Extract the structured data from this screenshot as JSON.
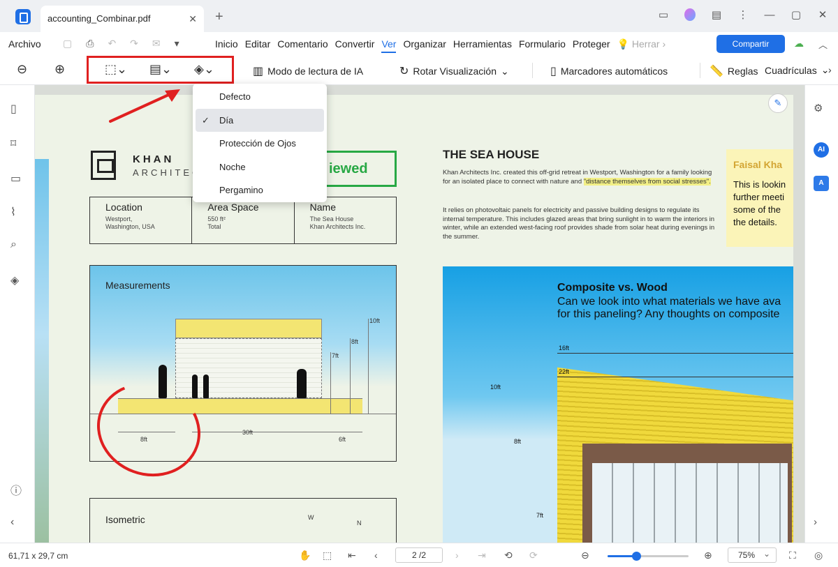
{
  "window": {
    "tab_title": "accounting_Combinar.pdf"
  },
  "menubar": {
    "file": "Archivo",
    "items": [
      "Inicio",
      "Editar",
      "Comentario",
      "Convertir",
      "Ver",
      "Organizar",
      "Herramientas",
      "Formulario",
      "Proteger",
      "Herrar"
    ],
    "active": "Ver",
    "share": "Compartir"
  },
  "toolbar": {
    "ai_reading": "Modo de lectura de IA",
    "rotate": "Rotar Visualización",
    "bookmarks": "Marcadores automáticos",
    "rules": "Reglas",
    "grids": "Cuadrículas"
  },
  "theme_menu": {
    "items": [
      "Defecto",
      "Día",
      "Protección de Ojos",
      "Noche",
      "Pergamino"
    ],
    "selected": "Día"
  },
  "document": {
    "khan_name": "KHAN",
    "khan_sub": "ARCHITEC",
    "stamp": "iewed",
    "info": [
      {
        "head": "Location",
        "value": "Westport,\nWashington, USA"
      },
      {
        "head": "Area Space",
        "value": "550 ft²\nTotal"
      },
      {
        "head": "Name",
        "value": "The Sea House\nKhan Architects Inc."
      }
    ],
    "measurements_title": "Measurements",
    "dims": {
      "d10": "10ft",
      "d8": "8ft",
      "d7": "7ft",
      "b8": "8ft",
      "b30": "30ft",
      "b6": "6ft"
    },
    "isometric_title": "Isometric",
    "compass_w": "W",
    "compass_n": "N",
    "sea_title": "THE SEA HOUSE",
    "sea_p1": "Khan Architects Inc. created this off-grid retreat in Westport, Washington for a family looking for an isolated place to connect with nature and",
    "sea_p1_hl": "\"distance themselves from social stresses\".",
    "sea_p2": "It relies on photovoltaic panels for electricity and passive building designs to regulate its internal temperature. This includes glazed areas that bring sunlight in to warm the interiors in winter, while an extended west-facing roof provides shade from solar heat during evenings in the summer.",
    "sticky_name": "Faisal Kha",
    "sticky_text": "This is lookin\nfurther meeti\nsome of the\nthe details.",
    "photo_title": "Composite vs. Wood",
    "photo_sub": "Can we look into what materials we have ava\nfor this paneling? Any thoughts on composite",
    "photo_dims": {
      "p16": "16ft",
      "p22": "22ft",
      "p10": "10ft",
      "p8": "8ft",
      "p7": "7ft"
    }
  },
  "statusbar": {
    "dimensions": "61,71 x 29,7 cm",
    "page": "2 /2",
    "zoom": "75%",
    "zoom_level": 0.35
  },
  "colors": {
    "accent": "#1f6fe5",
    "annotation_red": "#e02020",
    "stamp_green": "#27a844"
  }
}
